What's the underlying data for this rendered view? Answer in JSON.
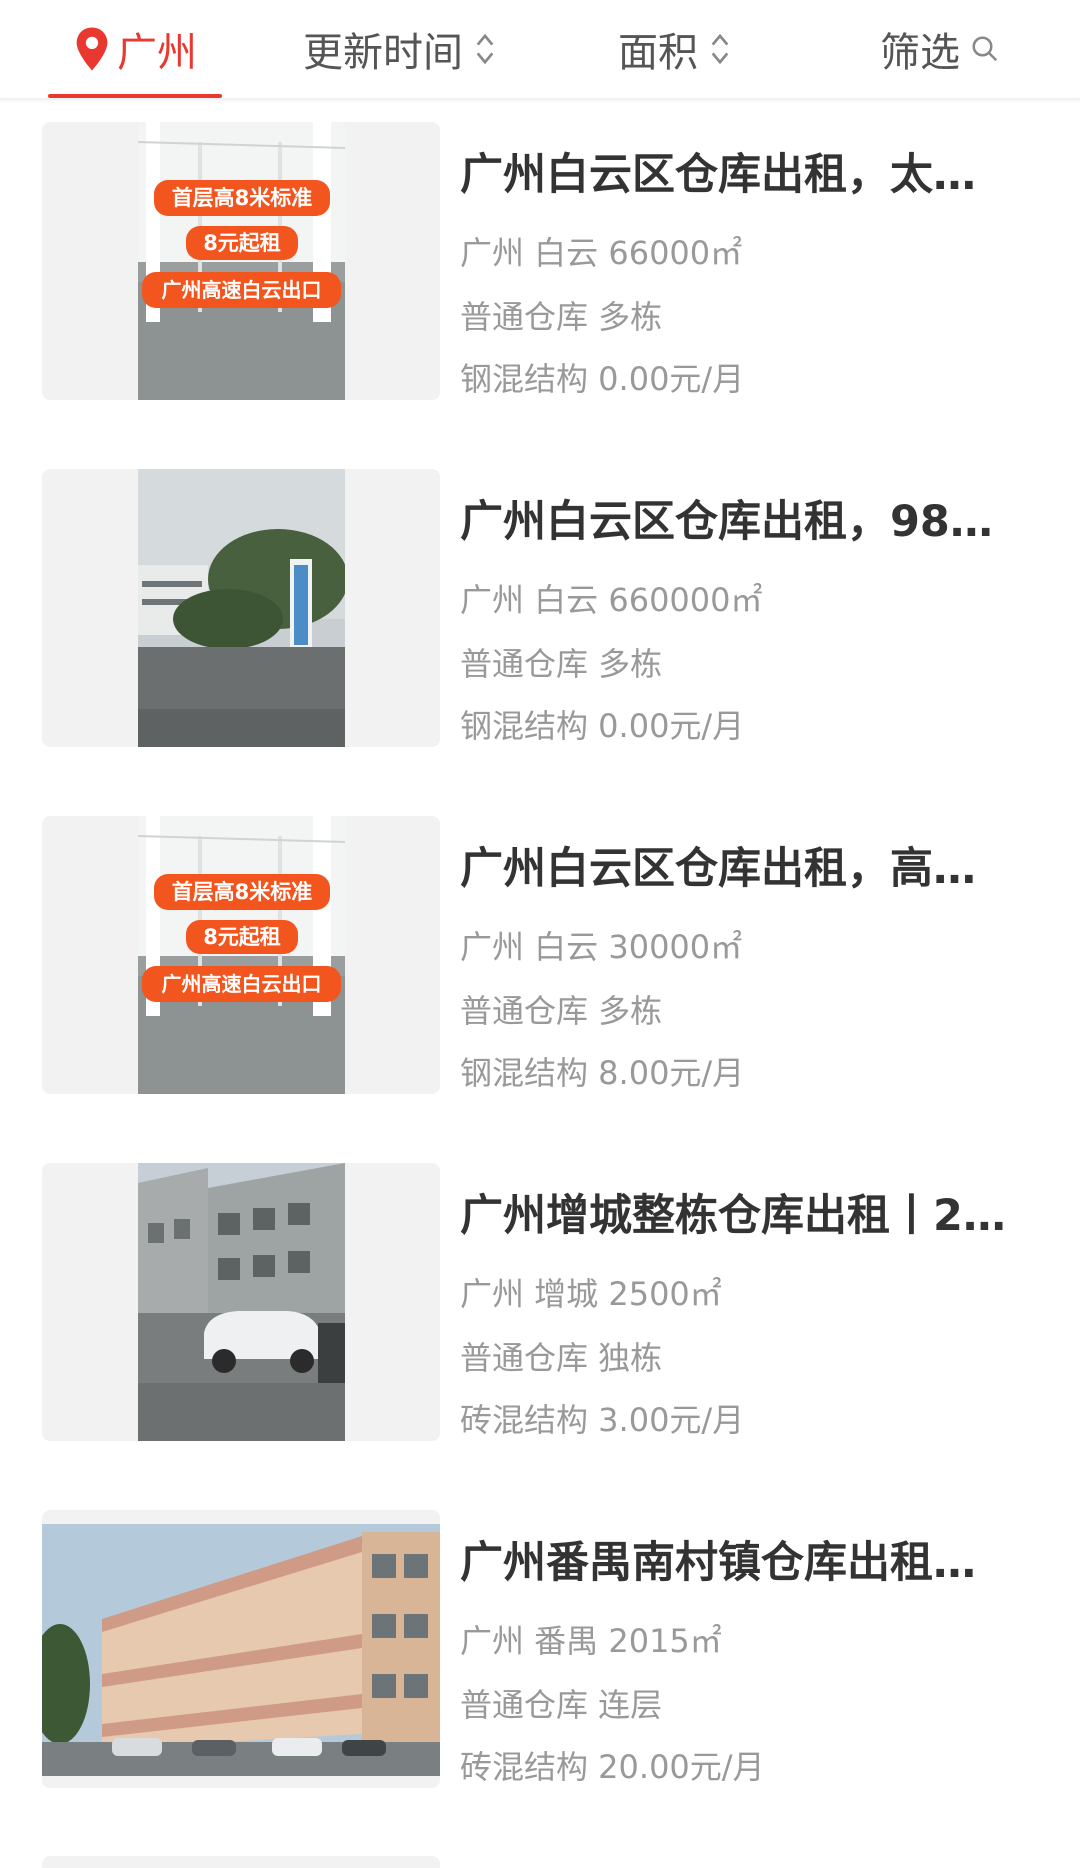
{
  "filter_bar": {
    "city": "广州",
    "sort_update": "更新时间",
    "sort_area": "面积",
    "filter": "筛选"
  },
  "listings": [
    {
      "title": "广州白云区仓库出租，太…",
      "location_area": "广州 白云 66000㎡",
      "type": "普通仓库 多栋",
      "structure_price": "钢混结构 0.00元/月",
      "image_kind": "poster",
      "banner": [
        "首层高8米标准",
        "8元起租",
        "广州高速白云出口"
      ]
    },
    {
      "title": "广州白云区仓库出租，98…",
      "location_area": "广州 白云 660000㎡",
      "type": "普通仓库 多栋",
      "structure_price": "钢混结构 0.00元/月",
      "image_kind": "street-sign"
    },
    {
      "title": "广州白云区仓库出租，高…",
      "location_area": "广州 白云 30000㎡",
      "type": "普通仓库 多栋",
      "structure_price": "钢混结构 8.00元/月",
      "image_kind": "poster",
      "banner": [
        "首层高8米标准",
        "8元起租",
        "广州高速白云出口"
      ]
    },
    {
      "title": "广州增城整栋仓库出租丨2…",
      "location_area": "广州 增城 2500㎡",
      "type": "普通仓库 独栋",
      "structure_price": "砖混结构 3.00元/月",
      "image_kind": "building-car"
    },
    {
      "title": "广州番禺南村镇仓库出租…",
      "location_area": "广州 番禺 2015㎡",
      "type": "普通仓库 连层",
      "structure_price": "砖混结构 20.00元/月",
      "image_kind": "building-wide"
    }
  ],
  "colors": {
    "accent": "#e8382f",
    "title": "#333333",
    "meta": "#999999",
    "banner_fill": "#f2551e"
  }
}
